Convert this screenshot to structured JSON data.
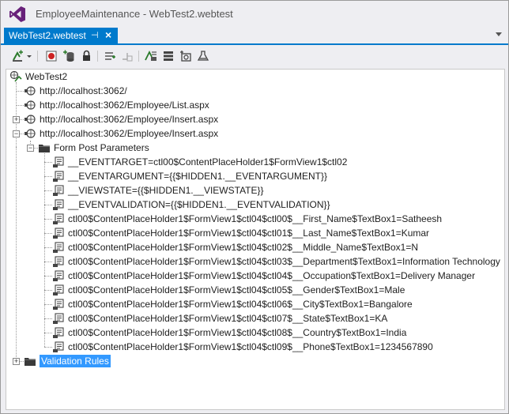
{
  "window": {
    "title": "EmployeeMaintenance - WebTest2.webtest"
  },
  "tab": {
    "label": "WebTest2.webtest",
    "pin_glyph": "⊣",
    "close_glyph": "×"
  },
  "colors": {
    "accent": "#007acc",
    "selection": "#3399ff"
  },
  "toolbar": {
    "buttons": [
      "add-request-icon",
      "dropdown-arrow-icon",
      "record-icon",
      "add-datasource-icon",
      "credentials-icon",
      "extraction-rule-icon",
      "validation-rule-icon",
      "parameterize-icon",
      "context-parameters-icon",
      "generate-code-icon",
      "plugin-icon"
    ]
  },
  "tree": {
    "root": "WebTest2",
    "requests": [
      "http://localhost:3062/",
      "http://localhost:3062/Employee/List.aspx",
      "http://localhost:3062/Employee/Insert.aspx",
      "http://localhost:3062/Employee/Insert.aspx"
    ],
    "form_post_folder": "Form Post Parameters",
    "params": [
      "__EVENTTARGET=ctl00$ContentPlaceHolder1$FormView1$ctl02",
      "__EVENTARGUMENT={{$HIDDEN1.__EVENTARGUMENT}}",
      "__VIEWSTATE={{$HIDDEN1.__VIEWSTATE}}",
      "__EVENTVALIDATION={{$HIDDEN1.__EVENTVALIDATION}}",
      "ctl00$ContentPlaceHolder1$FormView1$ctl04$ctl00$__First_Name$TextBox1=Satheesh",
      "ctl00$ContentPlaceHolder1$FormView1$ctl04$ctl01$__Last_Name$TextBox1=Kumar",
      "ctl00$ContentPlaceHolder1$FormView1$ctl04$ctl02$__Middle_Name$TextBox1=N",
      "ctl00$ContentPlaceHolder1$FormView1$ctl04$ctl03$__Department$TextBox1=Information Technology",
      "ctl00$ContentPlaceHolder1$FormView1$ctl04$ctl04$__Occupation$TextBox1=Delivery Manager",
      "ctl00$ContentPlaceHolder1$FormView1$ctl04$ctl05$__Gender$TextBox1=Male",
      "ctl00$ContentPlaceHolder1$FormView1$ctl04$ctl06$__City$TextBox1=Bangalore",
      "ctl00$ContentPlaceHolder1$FormView1$ctl04$ctl07$__State$TextBox1=KA",
      "ctl00$ContentPlaceHolder1$FormView1$ctl04$ctl08$__Country$TextBox1=India",
      "ctl00$ContentPlaceHolder1$FormView1$ctl04$ctl09$__Phone$TextBox1=1234567890"
    ],
    "validation_folder": "Validation Rules"
  }
}
